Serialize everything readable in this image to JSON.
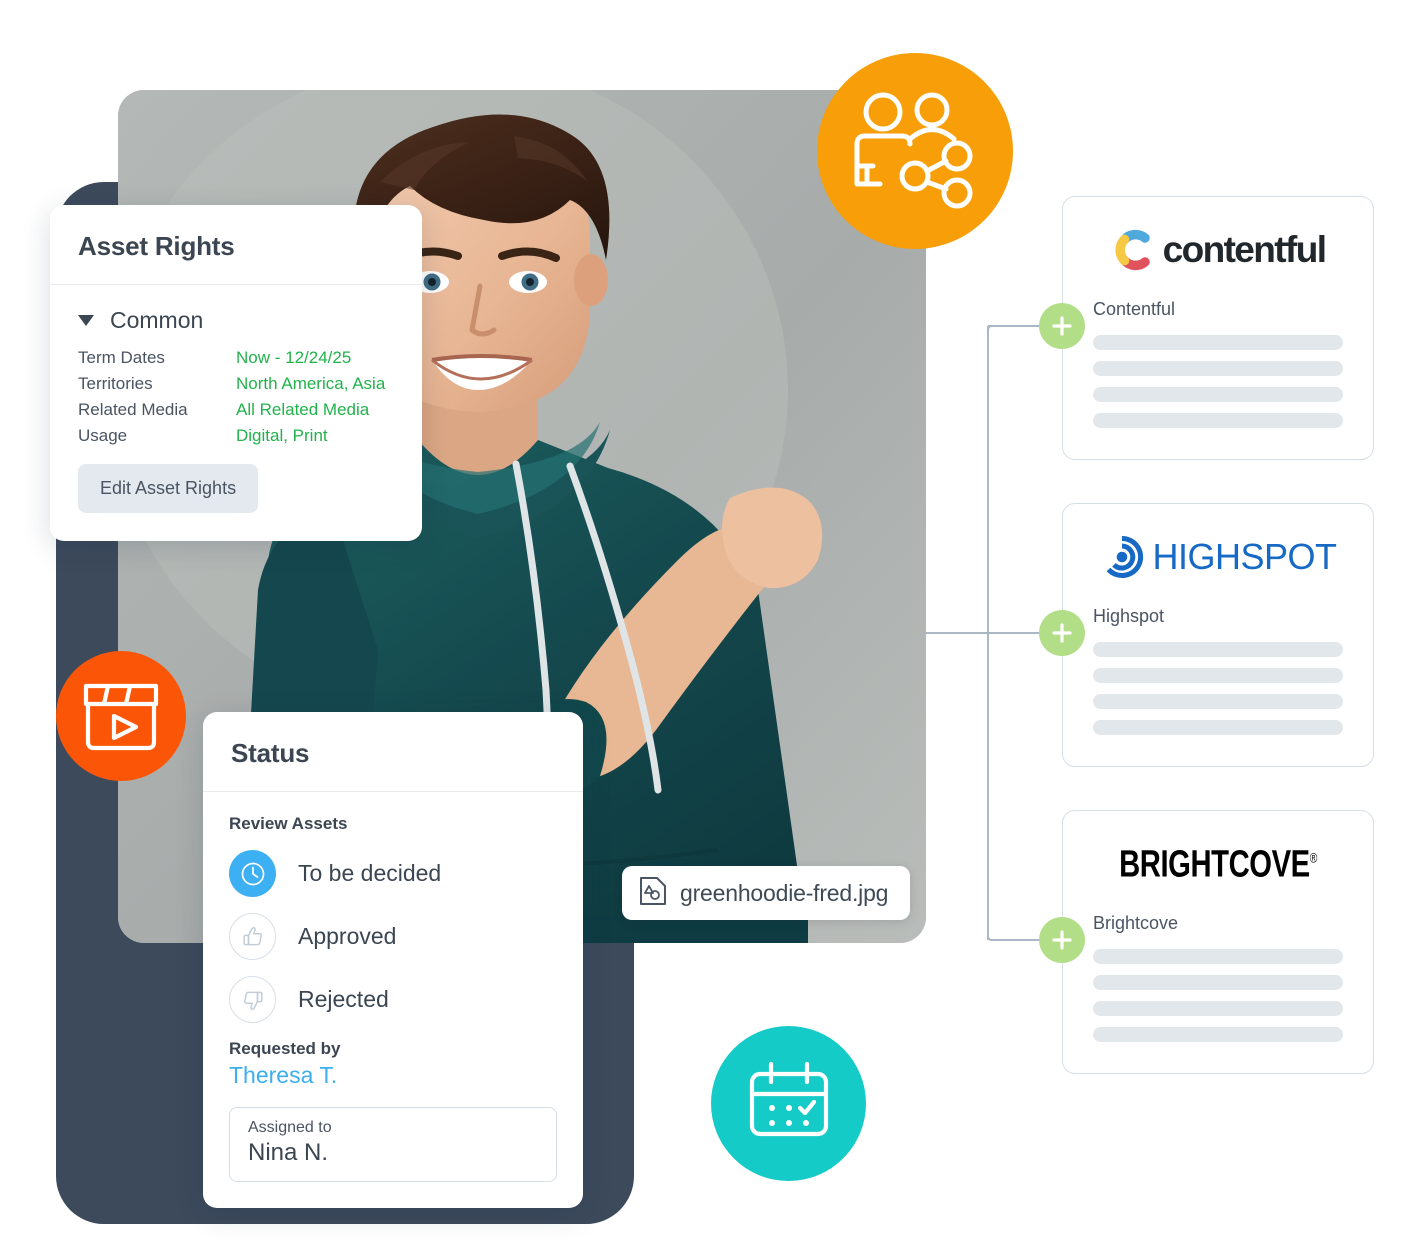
{
  "asset": {
    "filename": "greenhoodie-fred.jpg",
    "file_icon": "asset-shapes-icon"
  },
  "asset_rights": {
    "title": "Asset Rights",
    "group_label": "Common",
    "caret_icon": "caret-down-icon",
    "rows": [
      {
        "key": "Term Dates",
        "value": "Now - 12/24/25"
      },
      {
        "key": "Territories",
        "value": "North America, Asia"
      },
      {
        "key": "Related Media",
        "value": "All Related Media"
      },
      {
        "key": "Usage",
        "value": "Digital, Print"
      }
    ],
    "edit_button": "Edit Asset Rights",
    "value_color": "#22b24c"
  },
  "status": {
    "title": "Status",
    "section_label": "Review Assets",
    "options": [
      {
        "label": "To be decided",
        "icon": "clock-icon",
        "selected": true
      },
      {
        "label": "Approved",
        "icon": "thumbs-up-icon",
        "selected": false
      },
      {
        "label": "Rejected",
        "icon": "thumbs-down-icon",
        "selected": false
      }
    ],
    "requested_by_label": "Requested by",
    "requested_by_value": "Theresa T.",
    "assigned_to_label": "Assigned to",
    "assigned_to_value": "Nina N.",
    "active_color": "#3cb0f3",
    "link_color": "#3cafef"
  },
  "badges": [
    {
      "name": "share-people-icon",
      "color": "#f79e08"
    },
    {
      "name": "video-clapperboard-icon",
      "color": "#fb5607"
    },
    {
      "name": "calendar-check-icon",
      "color": "#14cbc8"
    }
  ],
  "integrations": [
    {
      "logo": "contentful-logo",
      "wordmark": "contentful",
      "title": "Contentful",
      "plus_icon": "plus-icon",
      "skeleton_rows": 4
    },
    {
      "logo": "highspot-logo",
      "wordmark": "HIGHSPOT",
      "title": "Highspot",
      "plus_icon": "plus-icon",
      "skeleton_rows": 4
    },
    {
      "logo": "brightcove-logo",
      "wordmark": "BRIGHTCOVE",
      "title": "Brightcove",
      "plus_icon": "plus-icon",
      "skeleton_rows": 4
    }
  ],
  "colors": {
    "plus_node": "#b2de88",
    "connector": "#aab8c6",
    "device_frame": "#3c4a5c",
    "skeleton": "#e2e7eb"
  }
}
